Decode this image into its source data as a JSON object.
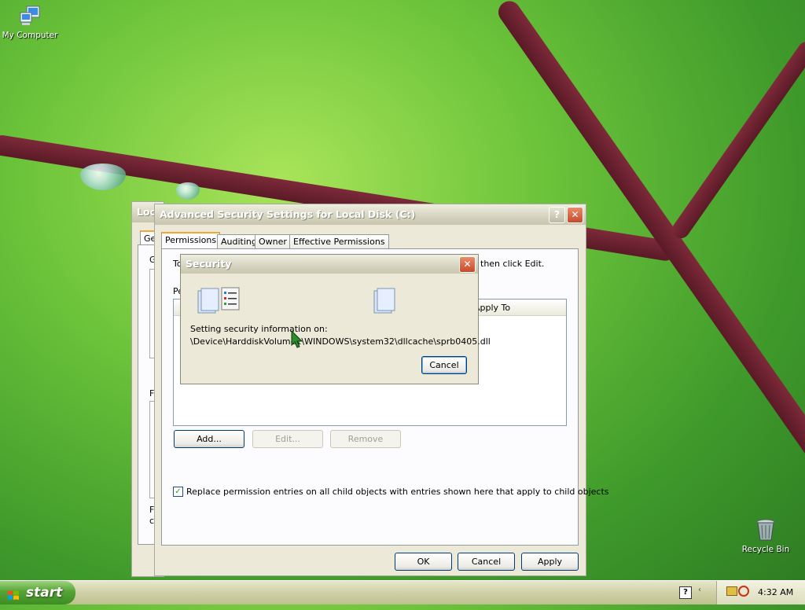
{
  "desktop": {
    "icons": [
      {
        "label": "My Computer",
        "icon": "computer-icon"
      },
      {
        "label": "Recycle Bin",
        "icon": "recycle-bin-icon"
      }
    ]
  },
  "back_window": {
    "title": "Loc",
    "tab_label": "Ge",
    "letters": [
      "G",
      "F",
      "F",
      "c"
    ]
  },
  "adv_window": {
    "title": "Advanced Security Settings for Local Disk (C:)",
    "help_glyph": "?",
    "close_glyph": "✕",
    "tabs": [
      "Permissions",
      "Auditing",
      "Owner",
      "Effective Permissions"
    ],
    "instruction_left": "To",
    "instruction_right": "then click Edit.",
    "perm_label": "Pe",
    "column_apply_to": "Apply To",
    "add_label": "Add...",
    "edit_label": "Edit...",
    "remove_label": "Remove",
    "checkbox_label": "Replace permission entries on all child objects with entries shown here that apply to child objects",
    "checkbox_checked": true,
    "ok_label": "OK",
    "cancel_label": "Cancel",
    "apply_label": "Apply"
  },
  "security_dialog": {
    "title": "Security",
    "close_glyph": "✕",
    "line1": "Setting security information on:",
    "path": "\\Device\\HarddiskVolume1\\WINDOWS\\system32\\dllcache\\sprb0405.dll",
    "cancel_label": "Cancel"
  },
  "taskbar": {
    "start_label": "start",
    "clock": "4:32 AM"
  }
}
